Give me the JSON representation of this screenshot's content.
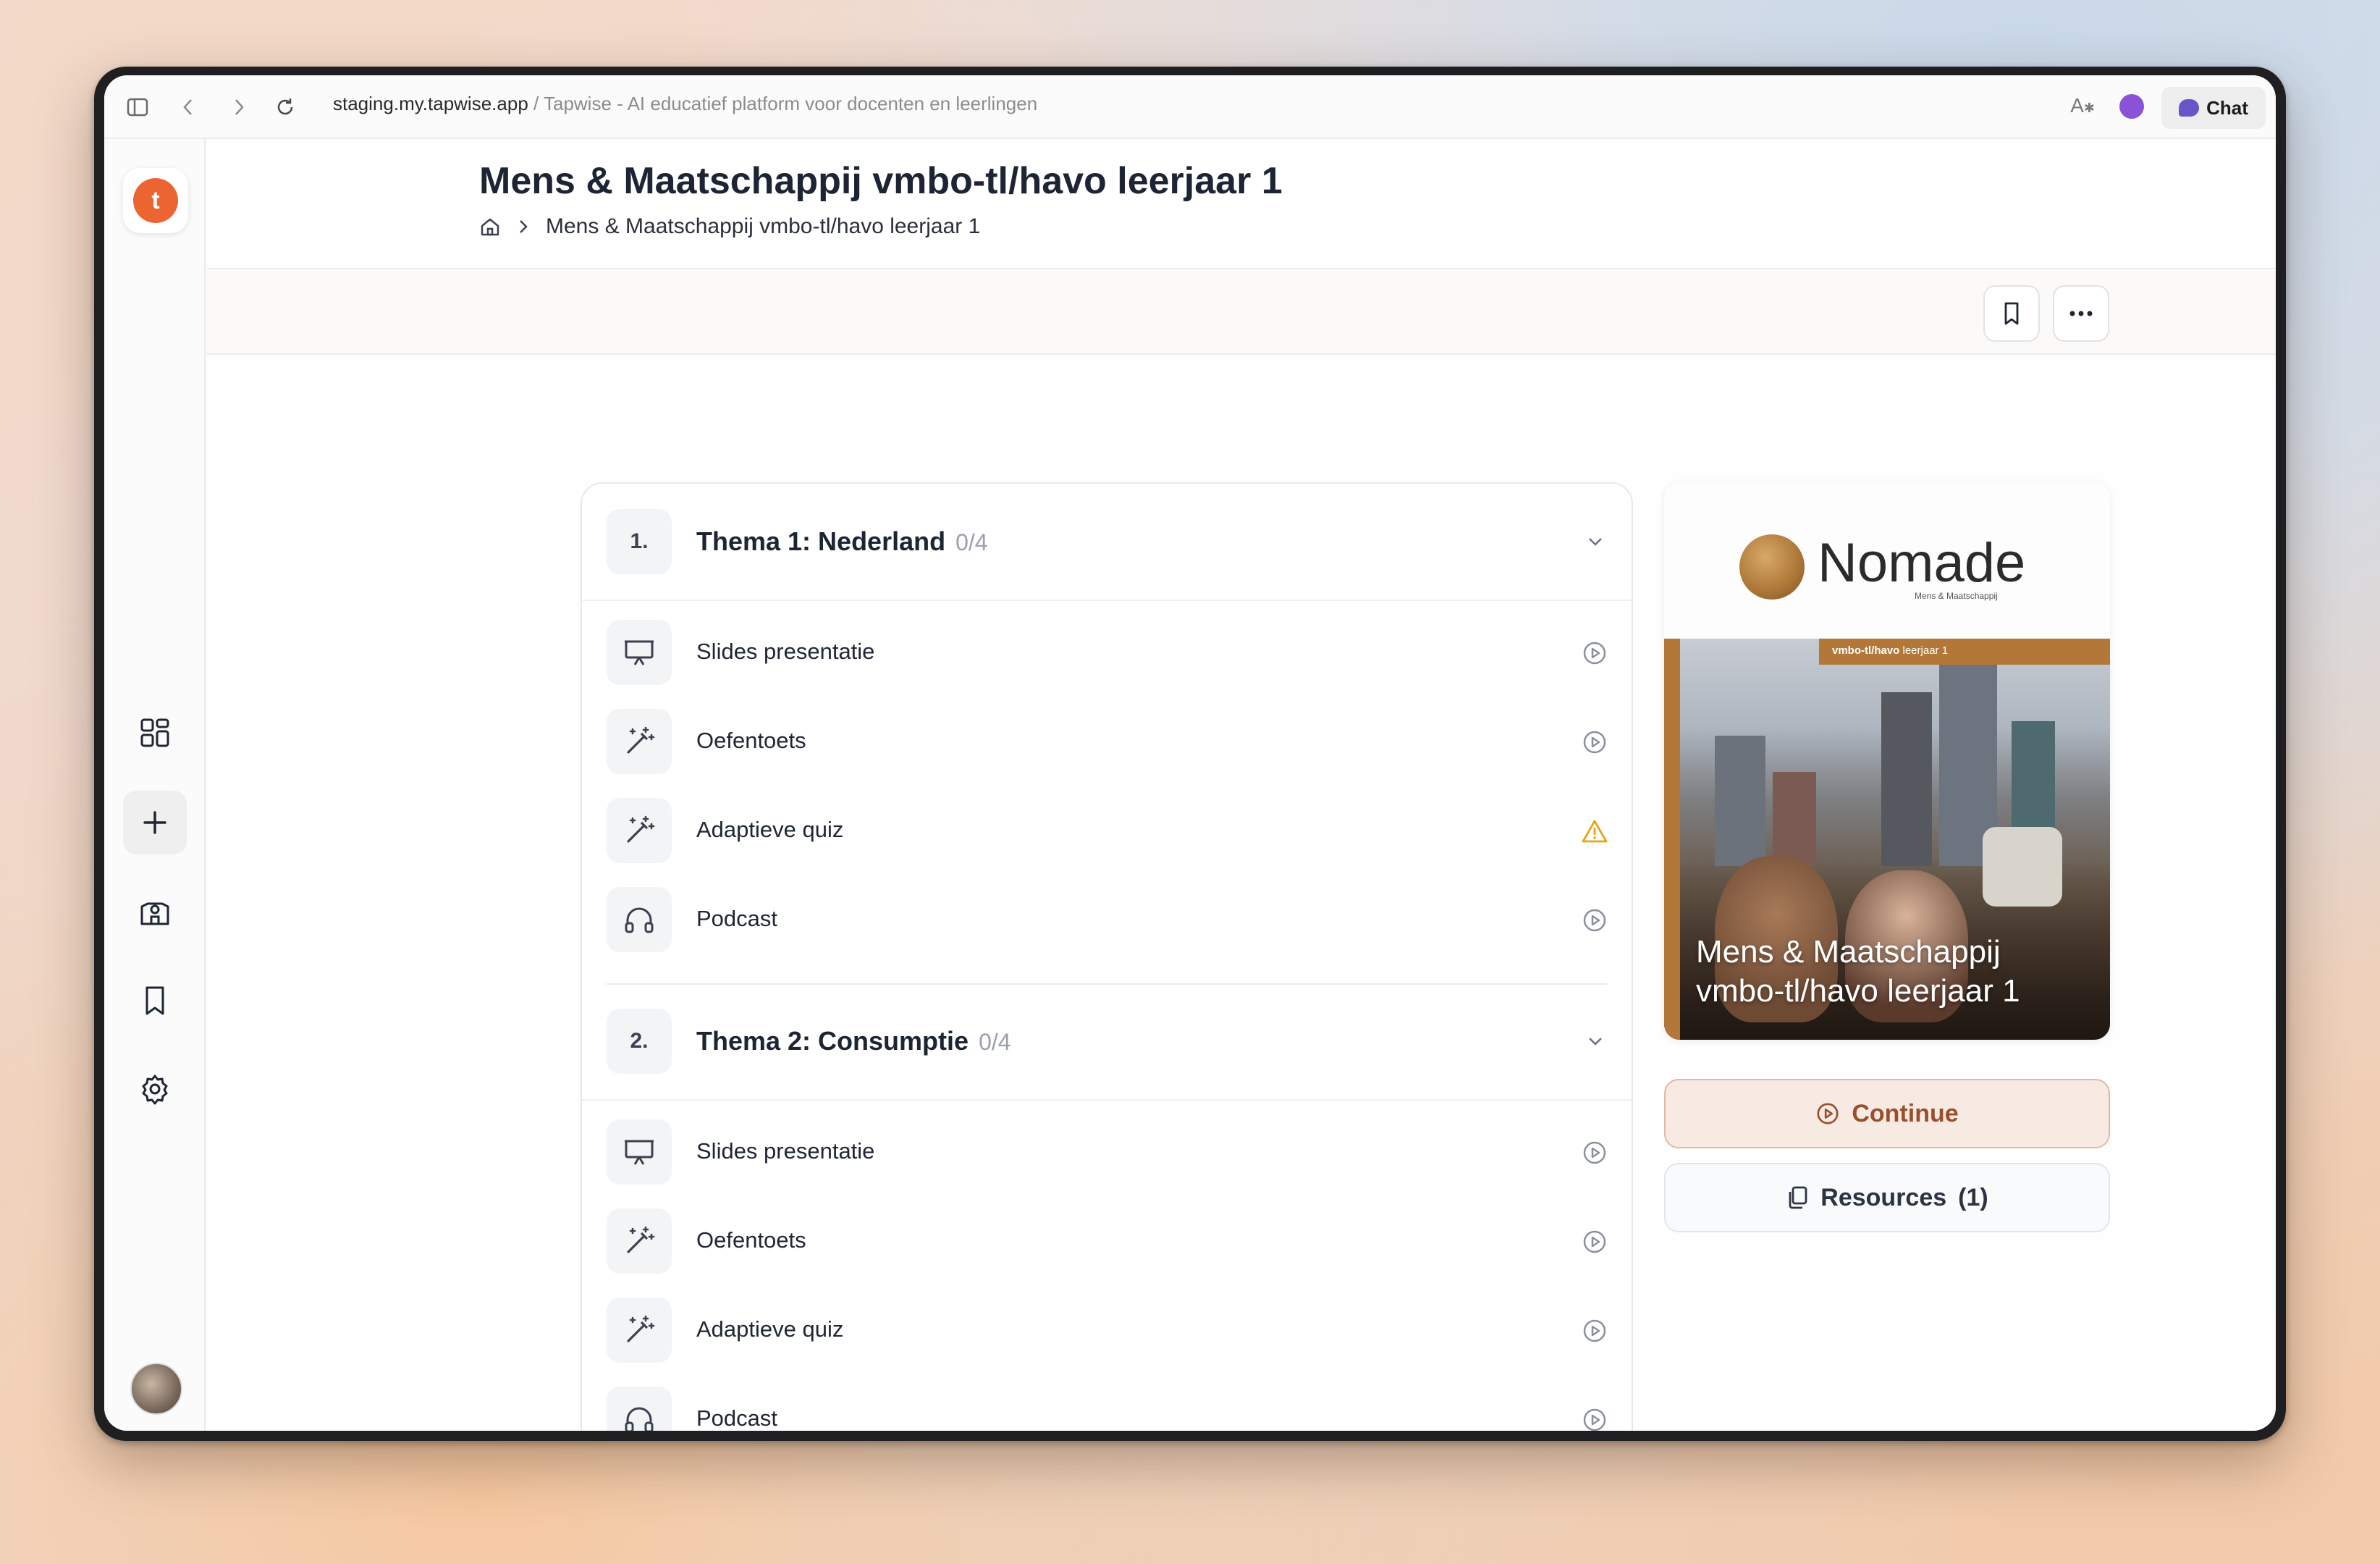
{
  "browser": {
    "url_domain": "staging.my.tapwise.app",
    "url_separator": " / ",
    "page_title": "Tapwise - AI educatief platform voor docenten en leerlingen",
    "chat_label": "Chat"
  },
  "sidebar": {
    "logo_text": "t",
    "items": [
      {
        "name": "dashboard",
        "icon": "grid-icon"
      },
      {
        "name": "create",
        "icon": "plus-icon"
      },
      {
        "name": "school",
        "icon": "school-icon"
      },
      {
        "name": "bookmarks",
        "icon": "bookmark-icon"
      },
      {
        "name": "settings",
        "icon": "gear-icon"
      }
    ]
  },
  "header": {
    "title": "Mens & Maatschappij vmbo-tl/havo leerjaar 1",
    "breadcrumb_current": "Mens & Maatschappij vmbo-tl/havo leerjaar 1"
  },
  "themes": [
    {
      "number": "1.",
      "title": "Thema 1: Nederland",
      "count": "0/4",
      "items": [
        {
          "label": "Slides presentatie",
          "icon": "presentation-icon",
          "status": "play"
        },
        {
          "label": "Oefentoets",
          "icon": "magic-wand-icon",
          "status": "play"
        },
        {
          "label": "Adaptieve quiz",
          "icon": "magic-wand-icon",
          "status": "warning"
        },
        {
          "label": "Podcast",
          "icon": "headphones-icon",
          "status": "play"
        }
      ]
    },
    {
      "number": "2.",
      "title": "Thema 2: Consumptie",
      "count": "0/4",
      "items": [
        {
          "label": "Slides presentatie",
          "icon": "presentation-icon",
          "status": "play"
        },
        {
          "label": "Oefentoets",
          "icon": "magic-wand-icon",
          "status": "play"
        },
        {
          "label": "Adaptieve quiz",
          "icon": "magic-wand-icon",
          "status": "play"
        },
        {
          "label": "Podcast",
          "icon": "headphones-icon",
          "status": "play"
        }
      ]
    }
  ],
  "cover": {
    "brand": "Nomade",
    "brand_sub": "Mens & Maatschappij",
    "band_bold": "vmbo-tl/havo",
    "band_rest": " leerjaar 1",
    "title_line1": "Mens & Maatschappij",
    "title_line2": "vmbo-tl/havo leerjaar 1"
  },
  "actions": {
    "continue_label": "Continue",
    "resources_label": "Resources",
    "resources_count": "(1)"
  },
  "colors": {
    "accent": "#ec6432",
    "continue_text": "#9a4f2c",
    "warning": "#e8a317"
  }
}
